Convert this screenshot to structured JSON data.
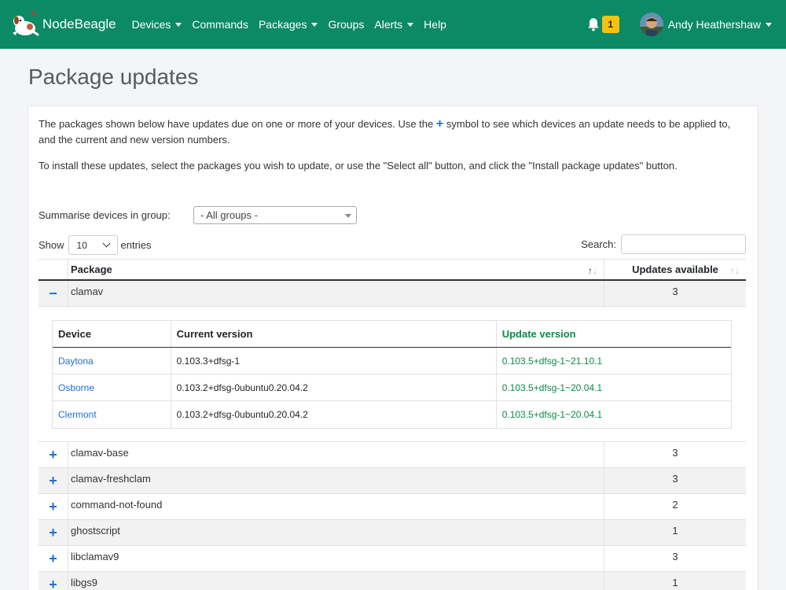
{
  "nav": {
    "brand": "NodeBeagle",
    "items": [
      {
        "label": "Devices",
        "dropdown": true
      },
      {
        "label": "Commands",
        "dropdown": false
      },
      {
        "label": "Packages",
        "dropdown": true
      },
      {
        "label": "Groups",
        "dropdown": false
      },
      {
        "label": "Alerts",
        "dropdown": true
      },
      {
        "label": "Help",
        "dropdown": false
      }
    ],
    "alert_count": "1",
    "user_name": "Andy Heathershaw",
    "color": "#0b8a65"
  },
  "page": {
    "title": "Package updates",
    "intro_1a": "The packages shown below have updates due on one or more of your devices. Use the",
    "intro_1b": "symbol to see which devices an update needs to be applied to, and the current and new version numbers.",
    "intro_2": "To install these updates, select the packages you wish to update, or use the \"Select all\" button, and click the \"Install package updates\" button.",
    "plus_symbol": "+"
  },
  "filters": {
    "group_label": "Summarise devices in group:",
    "group_value": "- All groups -",
    "show_label": "Show",
    "entries_value": "10",
    "entries_label": "entries",
    "search_label": "Search:"
  },
  "table": {
    "headers": {
      "package": "Package",
      "updates": "Updates available"
    },
    "rows": [
      {
        "package": "clamav",
        "count": "3",
        "toggle": "−"
      },
      {
        "package": "clamav-base",
        "count": "3",
        "toggle": "+"
      },
      {
        "package": "clamav-freshclam",
        "count": "3",
        "toggle": "+"
      },
      {
        "package": "command-not-found",
        "count": "2",
        "toggle": "+"
      },
      {
        "package": "ghostscript",
        "count": "1",
        "toggle": "+"
      },
      {
        "package": "libclamav9",
        "count": "3",
        "toggle": "+"
      },
      {
        "package": "libgs9",
        "count": "1",
        "toggle": "+"
      }
    ],
    "detail": {
      "headers": {
        "device": "Device",
        "current": "Current version",
        "update": "Update version"
      },
      "rows": [
        {
          "device": "Daytona",
          "current": "0.103.3+dfsg-1",
          "update": "0.103.5+dfsg-1~21.10.1"
        },
        {
          "device": "Osborne",
          "current": "0.103.2+dfsg-0ubuntu0.20.04.2",
          "update": "0.103.5+dfsg-1~20.04.1"
        },
        {
          "device": "Clermont",
          "current": "0.103.2+dfsg-0ubuntu0.20.04.2",
          "update": "0.103.5+dfsg-1~20.04.1"
        }
      ]
    }
  }
}
